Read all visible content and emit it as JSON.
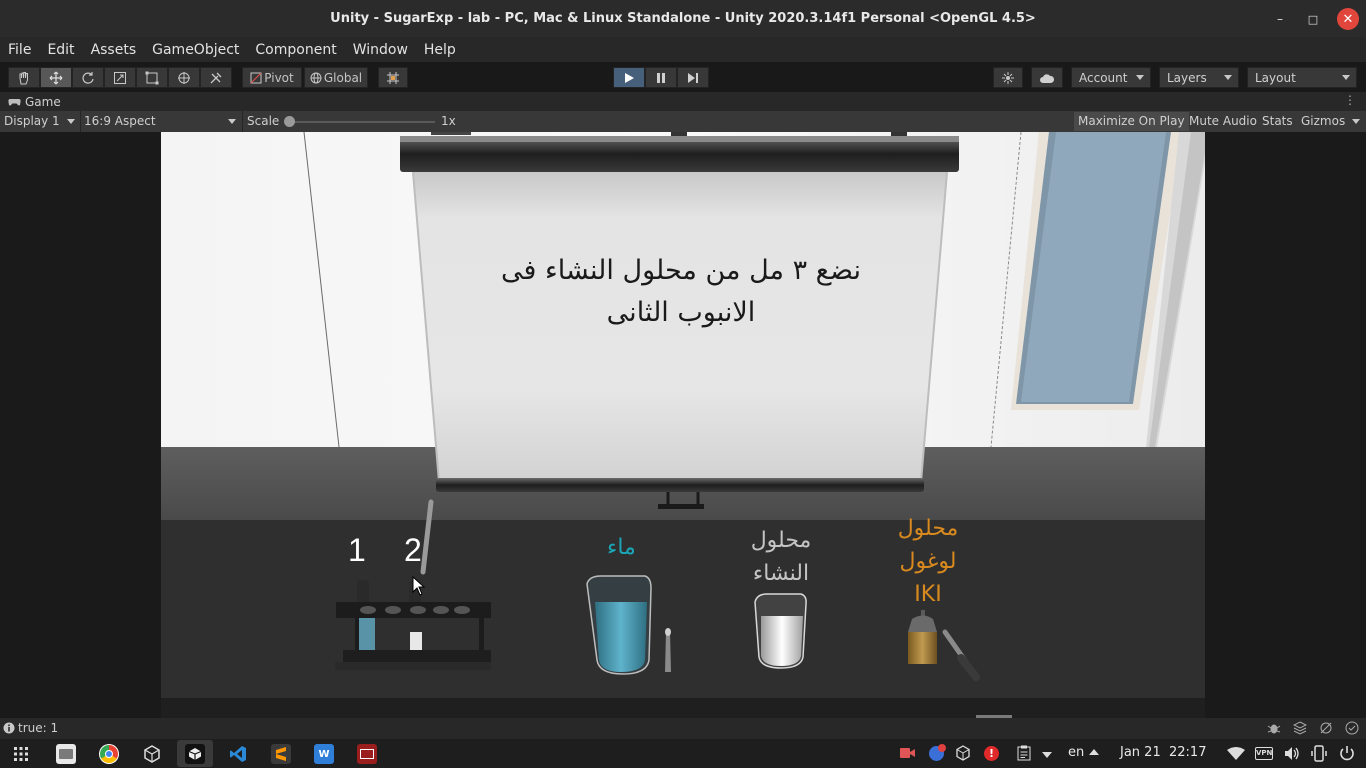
{
  "window": {
    "title": "Unity - SugarExp - lab - PC, Mac & Linux Standalone - Unity 2020.3.14f1 Personal <OpenGL 4.5>",
    "controls": {
      "minimize": "–",
      "maximize": "□",
      "close": "✕"
    }
  },
  "menu": [
    "File",
    "Edit",
    "Assets",
    "GameObject",
    "Component",
    "Window",
    "Help"
  ],
  "toolbar": {
    "pivot_label": "Pivot",
    "global_label": "Global",
    "account_label": "Account",
    "layers_label": "Layers",
    "layout_label": "Layout",
    "accent_color": "#46607c"
  },
  "game_view": {
    "tab_label": "Game",
    "display": "Display 1",
    "aspect": "16:9 Aspect",
    "scale_label": "Scale",
    "scale_value": "1x",
    "maximize_on_play": "Maximize On Play",
    "mute_audio": "Mute Audio",
    "stats": "Stats",
    "gizmos": "Gizmos"
  },
  "scene": {
    "board_line1": "نضع ٣ مل من محلول النشاء فى",
    "board_line2": "الانبوب الثانى",
    "tube_label_1": "1",
    "tube_label_2": "2",
    "water_label": "ماء",
    "starch_label_1": "محلول",
    "starch_label_2": "النشاء",
    "iodine_label_1": "محلول",
    "iodine_label_2": "لوغول",
    "iodine_label_3": "IKI",
    "colors": {
      "water": "#1aa6b7",
      "starch": "#c4c4c4",
      "iodine": "#d98a1e"
    }
  },
  "status": {
    "message": "true: 1"
  },
  "taskbar": {
    "language": "en",
    "date": "Jan 21",
    "time": "22:17"
  }
}
